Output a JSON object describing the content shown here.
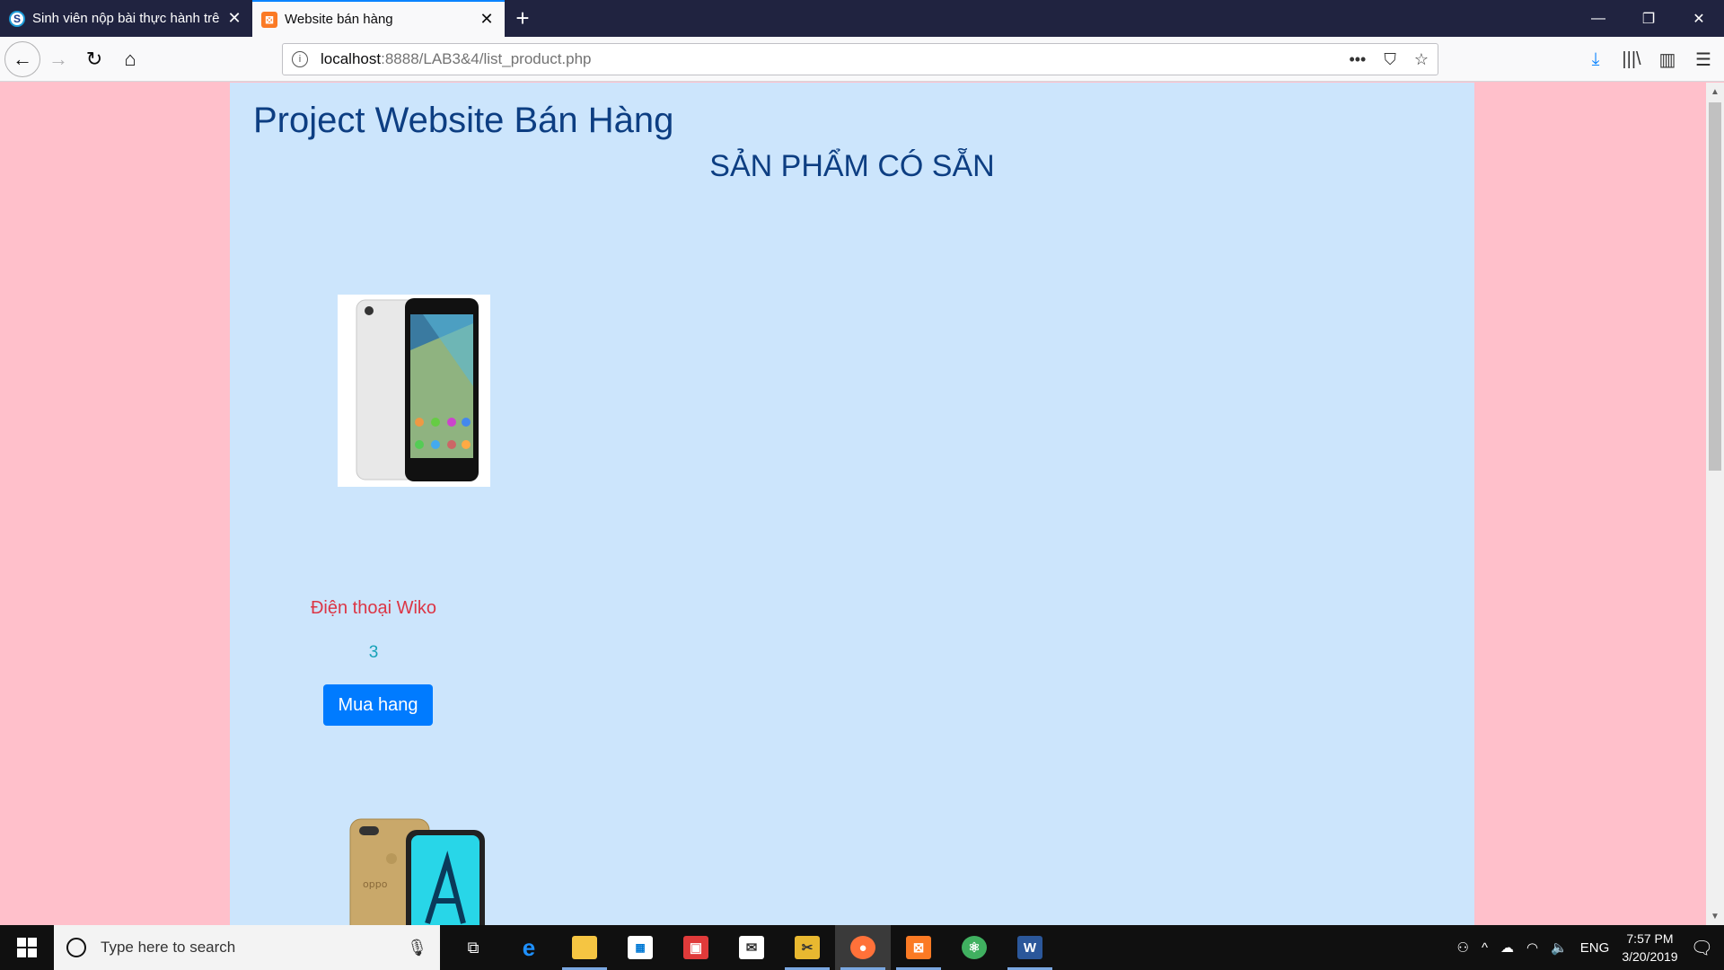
{
  "browser": {
    "tabs": [
      {
        "title": "Sinh viên nộp bài thực hành trê",
        "active": false
      },
      {
        "title": "Website bán hàng",
        "active": true
      }
    ],
    "url_host": "localhost",
    "url_rest": ":8888/LAB3&4/list_product.php"
  },
  "page": {
    "site_title": "Project Website Bán Hàng",
    "section_title": "SẢN PHẨM CÓ SẴN",
    "products": [
      {
        "name": "Điện thoại Wiko",
        "quantity": "3",
        "buy_label": "Mua hang"
      }
    ]
  },
  "taskbar": {
    "search_placeholder": "Type here to search",
    "language": "ENG",
    "time": "7:57 PM",
    "date": "3/20/2019"
  },
  "colors": {
    "page_bg": "#ffc0cb",
    "container_bg": "#cce5fc",
    "title_color": "#0d3e82",
    "product_name_color": "#dc3545",
    "qty_color": "#17a2b8",
    "button_color": "#007bff"
  }
}
